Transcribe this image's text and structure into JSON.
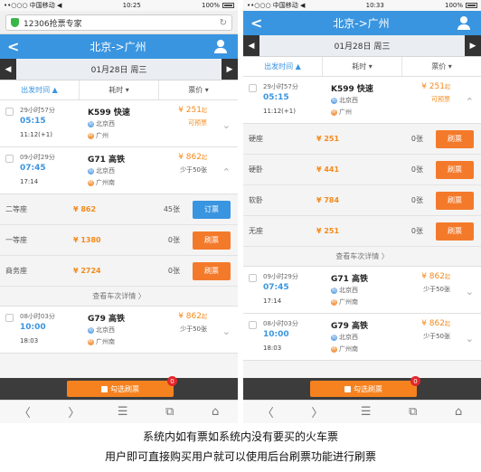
{
  "status_bar": {
    "carrier": "••○○○ 中国移动 ◀",
    "time": "10:25",
    "battery": "100%"
  },
  "status_bar_right": {
    "carrier": "••○○○ 中国移动 ◀",
    "time": "10:33",
    "battery": "100%"
  },
  "browser": {
    "url_title": "12306抢票专家"
  },
  "header": {
    "back": "<",
    "title": "北京->广州"
  },
  "date_bar": {
    "prev": "◀",
    "date": "01月28日 周三",
    "next": "▶"
  },
  "sort": {
    "depart": "出发时间 ▲",
    "duration": "耗时 ▾",
    "price": "票价 ▾"
  },
  "left": {
    "trains": [
      {
        "duration": "29小时57分",
        "depart": "05:15",
        "arrive": "11:12(+1)",
        "number": "K599 快速",
        "from": "北京西",
        "to": "广州",
        "price": "¥ 251",
        "price_suffix": "起",
        "status": "可预票",
        "chev": "⌄"
      },
      {
        "duration": "09小时29分",
        "depart": "07:45",
        "arrive": "17:14",
        "number": "G71 高铁",
        "from": "北京西",
        "to": "广州南",
        "price": "¥ 862",
        "price_suffix": "起",
        "status": "少于50张",
        "chev": "⌃"
      },
      {
        "duration": "08小时03分",
        "depart": "10:00",
        "arrive": "18:03",
        "number": "G79 高铁",
        "from": "北京西",
        "to": "广州南",
        "price": "¥ 862",
        "price_suffix": "起",
        "status": "少于50张",
        "chev": "⌄"
      }
    ],
    "seats": [
      {
        "name": "二等座",
        "price": "¥ 862",
        "count": "45张",
        "button": "订票"
      },
      {
        "name": "一等座",
        "price": "¥ 1380",
        "count": "0张",
        "button": "刷票"
      },
      {
        "name": "商务座",
        "price": "¥ 2724",
        "count": "0张",
        "button": "刷票"
      }
    ],
    "more": "查看车次详情 〉"
  },
  "right": {
    "trains": [
      {
        "duration": "29小时57分",
        "depart": "05:15",
        "arrive": "11:12(+1)",
        "number": "K599 快速",
        "from": "北京西",
        "to": "广州",
        "price": "¥ 251",
        "price_suffix": "起",
        "status": "可预票",
        "chev": "⌃"
      },
      {
        "duration": "09小时29分",
        "depart": "07:45",
        "arrive": "17:14",
        "number": "G71 高铁",
        "from": "北京西",
        "to": "广州南",
        "price": "¥ 862",
        "price_suffix": "起",
        "status": "少于50张",
        "chev": "⌄"
      },
      {
        "duration": "08小时03分",
        "depart": "10:00",
        "arrive": "18:03",
        "number": "G79 高铁",
        "from": "北京西",
        "to": "广州南",
        "price": "¥ 862",
        "price_suffix": "起",
        "status": "少于50张",
        "chev": "⌄"
      }
    ],
    "seats": [
      {
        "name": "硬座",
        "price": "¥ 251",
        "count": "0张",
        "button": "刷票"
      },
      {
        "name": "硬卧",
        "price": "¥ 441",
        "count": "0张",
        "button": "刷票"
      },
      {
        "name": "软卧",
        "price": "¥ 784",
        "count": "0张",
        "button": "刷票"
      },
      {
        "name": "无座",
        "price": "¥ 251",
        "count": "0张",
        "button": "刷票"
      }
    ],
    "more": "查看车次详情 〉"
  },
  "bottom": {
    "button": "勾选刷票",
    "badge": "0"
  },
  "nav": {
    "back": "〈",
    "forward": "〉",
    "menu": "☰",
    "tabs": "⧉",
    "home": "⌂"
  },
  "caption": {
    "line1": "系统内如有票如系统内没有要买的火车票",
    "line2": "用户即可直接购买用户就可以使用后台刷票功能进行刷票"
  },
  "colors": {
    "accent": "#3a95e0",
    "orange": "#f47a2b",
    "price": "#f28a1d"
  }
}
